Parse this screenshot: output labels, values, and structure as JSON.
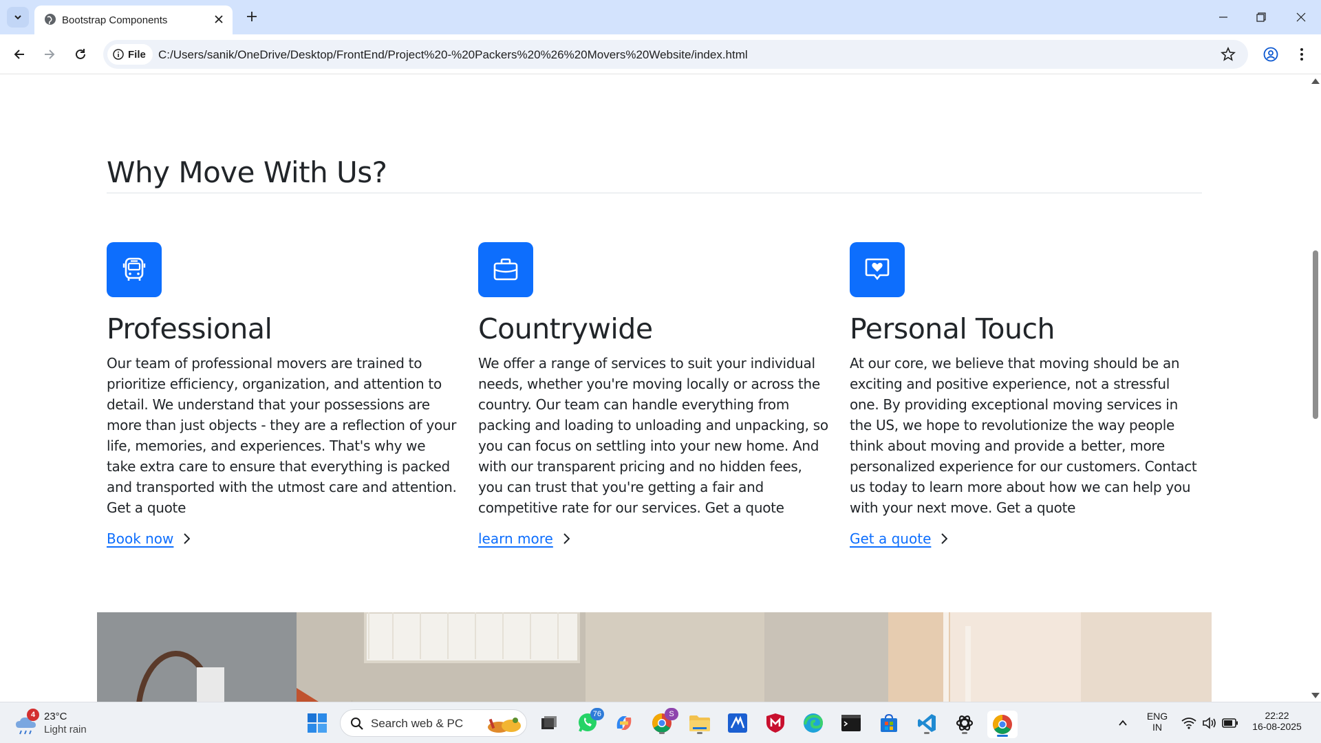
{
  "browser": {
    "tab_title": "Bootstrap Components",
    "address_chip": "File",
    "url": "C:/Users/sanik/OneDrive/Desktop/FrontEnd/Project%20-%20Packers%20%26%20Movers%20Website/index.html"
  },
  "page": {
    "section_title": "Why Move With Us?",
    "features": [
      {
        "icon": "bus-icon",
        "title": "Professional",
        "text": "Our team of professional movers are trained to prioritize efficiency, organization, and attention to detail. We understand that your possessions are more than just objects - they are a reflection of your life, memories, and experiences. That's why we take extra care to ensure that everything is packed and transported with the utmost care and attention. Get a quote",
        "link": "Book now"
      },
      {
        "icon": "briefcase-icon",
        "title": "Countrywide",
        "text": "We offer a range of services to suit your individual needs, whether you're moving locally or across the country. Our team can handle everything from packing and loading to unloading and unpacking, so you can focus on settling into your new home. And with our transparent pricing and no hidden fees, you can trust that you're getting a fair and competitive rate for our services. Get a quote",
        "link": "learn more"
      },
      {
        "icon": "chat-heart-icon",
        "title": "Personal Touch",
        "text": "At our core, we believe that moving should be an exciting and positive experience, not a stressful one. By providing exceptional moving services in the US, we hope to revolutionize the way people think about moving and provide a better, more personalized experience for our customers. Contact us today to learn more about how we can help you with your next move. Get a quote",
        "link": "Get a quote"
      }
    ],
    "accent_color": "#0d6efd"
  },
  "taskbar": {
    "weather_badge": "4",
    "temperature": "23°C",
    "condition": "Light rain",
    "search_placeholder": "Search web & PC",
    "whatsapp_badge": "76",
    "chrome_profile_badge": "S",
    "language_line1": "ENG",
    "language_line2": "IN",
    "time": "22:22",
    "date": "16-08-2025"
  }
}
